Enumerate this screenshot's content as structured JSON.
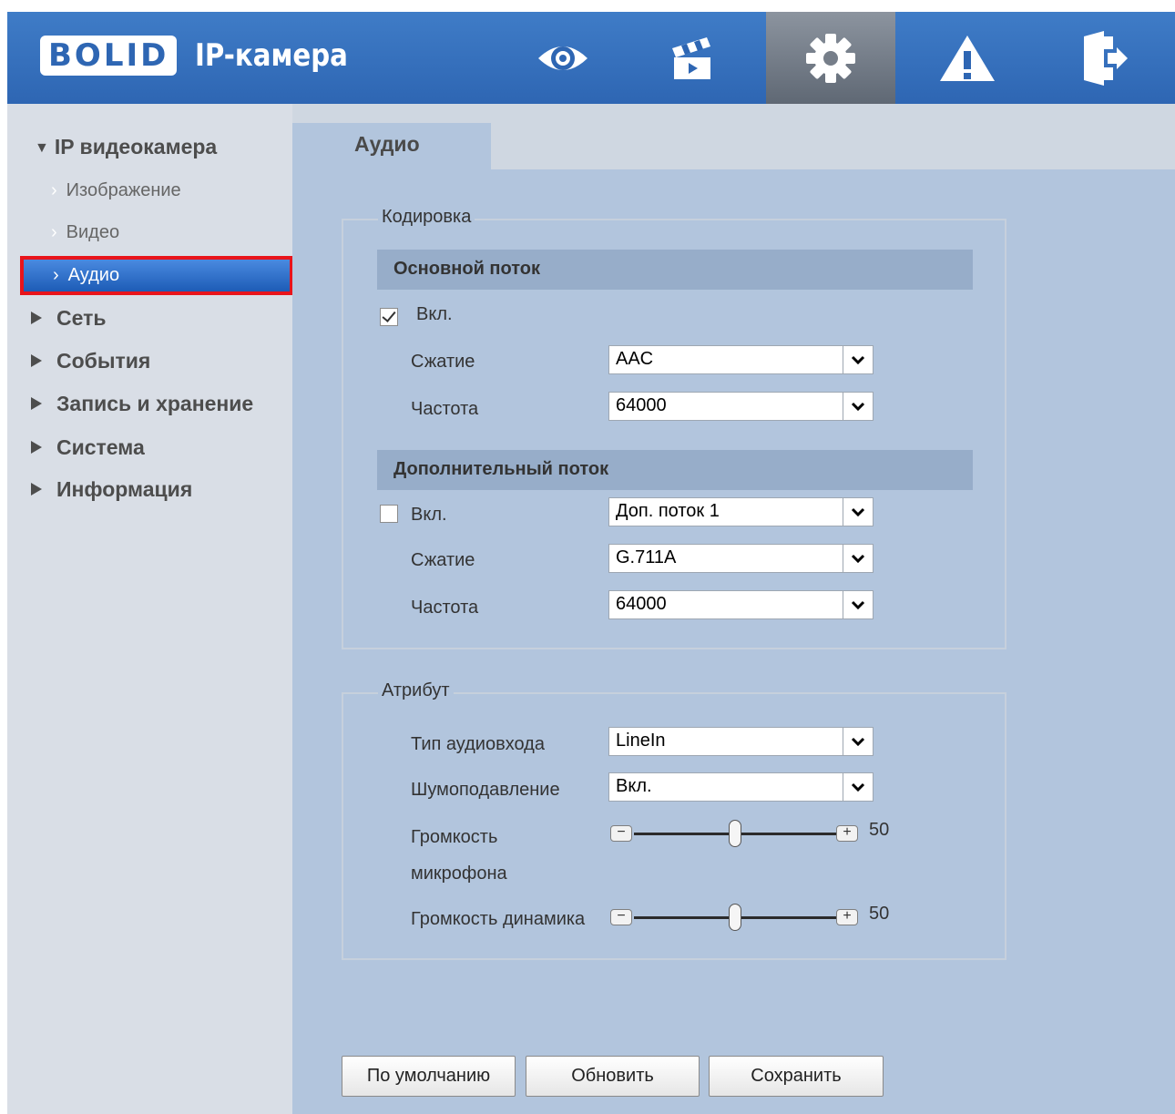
{
  "app": {
    "logo": "BOLID",
    "title": "IP-камера"
  },
  "topnav": [
    {
      "name": "live-view",
      "icon": "eye-icon",
      "active": false
    },
    {
      "name": "playback",
      "icon": "clapperboard-icon",
      "active": false
    },
    {
      "name": "settings",
      "icon": "gear-icon",
      "active": true
    },
    {
      "name": "alarm",
      "icon": "warning-icon",
      "active": false
    },
    {
      "name": "logout",
      "icon": "logout-icon",
      "active": false
    }
  ],
  "sidebar": {
    "root": "IP видеокамера",
    "subitems": [
      "Изображение",
      "Видео",
      "Аудио"
    ],
    "active": "Аудио",
    "groups": [
      "Сеть",
      "События",
      "Запись и хранение",
      "Система",
      "Информация"
    ]
  },
  "tab": "Аудио",
  "encoding": {
    "legend": "Кодировка",
    "main_stream": {
      "title": "Основной поток",
      "enable_label": "Вкл.",
      "enabled": true,
      "compression_label": "Сжатие",
      "compression_value": "AAC",
      "frequency_label": "Частота",
      "frequency_value": "64000"
    },
    "extra_stream": {
      "title": "Дополнительный поток",
      "enable_label": "Вкл.",
      "enabled": false,
      "stream_value": "Доп. поток 1",
      "compression_label": "Сжатие",
      "compression_value": "G.711A",
      "frequency_label": "Частота",
      "frequency_value": "64000"
    }
  },
  "attribute": {
    "legend": "Атрибут",
    "input_type_label": "Тип аудиовхода",
    "input_type_value": "LineIn",
    "noise_label": "Шумоподавление",
    "noise_value": "Вкл.",
    "mic_volume_label_1": "Громкость",
    "mic_volume_label_2": "микрофона",
    "mic_volume_value": "50",
    "speaker_volume_label": "Громкость динамика",
    "speaker_volume_value": "50"
  },
  "buttons": {
    "default": "По умолчанию",
    "refresh": "Обновить",
    "save": "Сохранить"
  },
  "colors": {
    "header": "#3470bd",
    "active_item": "#2e6dc6",
    "highlight_border": "#e8141b",
    "panel": "#b2c5dd"
  }
}
